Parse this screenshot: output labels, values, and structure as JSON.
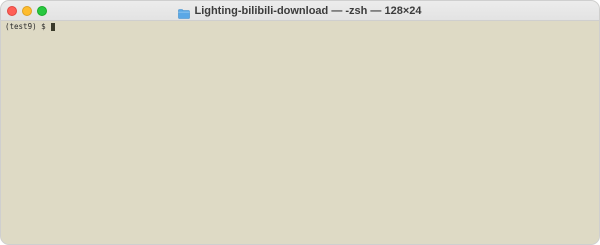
{
  "window": {
    "title": "Lighting-bilibili-download — -zsh — 128×24",
    "title_icon": "folder-icon",
    "colors": {
      "terminal_background": "#dedac5",
      "text": "#2b2b2b",
      "close": "#ff5f57",
      "minimize": "#febc2e",
      "zoom": "#28c840"
    }
  },
  "terminal": {
    "prompt": "(test9) $ "
  }
}
